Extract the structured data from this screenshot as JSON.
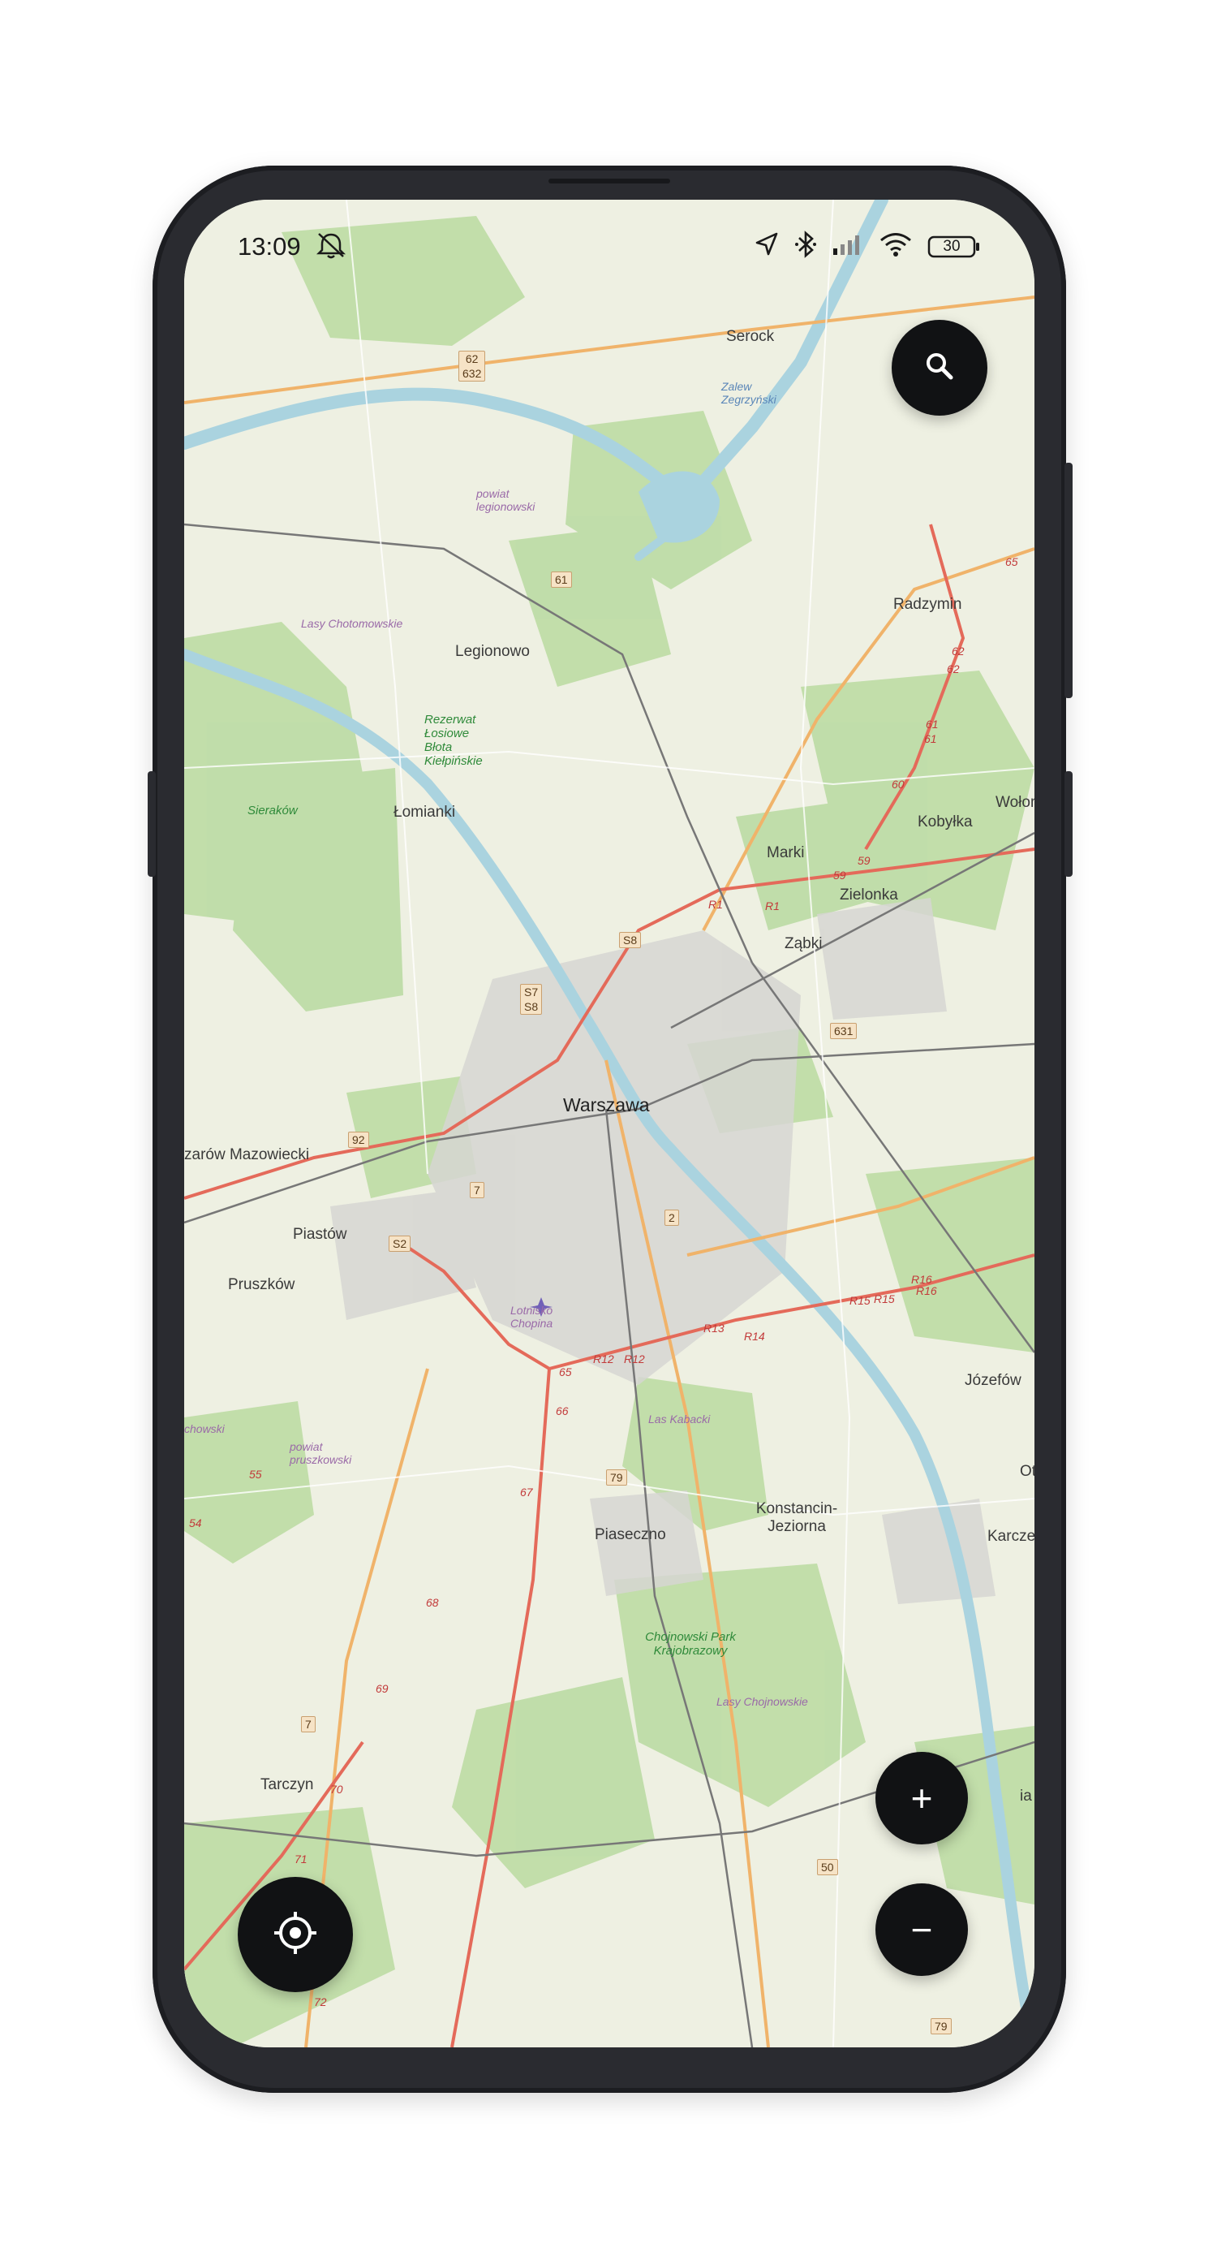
{
  "status_bar": {
    "time": "13:09",
    "battery": "30",
    "icons": [
      "bell-muted-icon",
      "location-arrow-icon",
      "bluetooth-icon",
      "signal-icon",
      "wifi-icon",
      "battery-icon"
    ]
  },
  "controls": {
    "search_icon": "search-icon",
    "zoom_in": "+",
    "zoom_out": "−",
    "locate_icon": "my-location-icon"
  },
  "map": {
    "places": {
      "serock": "Serock",
      "zalew": "Zalew Zegrzyński",
      "powiat_legionowski": "powiat legionowski",
      "lasy_chotomowskie": "Lasy Chotomowskie",
      "legionowo": "Legionowo",
      "radzymin": "Radzymin",
      "rezerwat": "Rezerwat Łosiowe Błota Kiełpińskie",
      "lomianki": "Łomianki",
      "sierakow": "Sieraków",
      "kobylka": "Kobyłka",
      "wolomin": "Wołom",
      "marki": "Marki",
      "zielonka": "Zielonka",
      "zabki": "Ząbki",
      "warszawa": "Warszawa",
      "ozarow": "zarów Mazowiecki",
      "piastow": "Piastów",
      "pruszkow": "Pruszków",
      "lotnisko": "Lotnisko Chopina",
      "jozefow": "Józefów",
      "powiat_pruszkowski": "powiat pruszkowski",
      "ochowski": "chowski",
      "las_kabacki": "Las Kabacki",
      "konstancin": "Konstancin-Jeziorna",
      "piaseczno": "Piaseczno",
      "karczew": "Karczew",
      "ot": "Ot",
      "chojnowski": "Chojnowski Park Krajobrazowy",
      "lasy_chojnowskie": "Lasy Chojnowskie",
      "tarczyn": "Tarczyn",
      "ia": "ia"
    },
    "road_shields": {
      "s62": "62\n632",
      "s61": "61",
      "s631": "631",
      "s8": "S8",
      "s57": "S7\nS8",
      "s92": "92",
      "s7a": "7",
      "s2": "2",
      "s52": "S2",
      "s79": "79",
      "s7b": "7",
      "s50": "50",
      "s79b": "79"
    },
    "route_labels": [
      "65",
      "62",
      "62",
      "61",
      "61",
      "60",
      "59",
      "59",
      "R1",
      "R1",
      "R16",
      "R15",
      "R15",
      "R16",
      "R13",
      "R14",
      "R12",
      "R12",
      "65",
      "66",
      "67",
      "55",
      "54",
      "68",
      "69",
      "70",
      "71",
      "72"
    ]
  },
  "colors": {
    "background": "#ffffff",
    "phone_frame": "#2a2b30",
    "map_land": "#eef0e2",
    "forest": "#bcdca4",
    "water": "#aad3df",
    "fab": "#111214"
  }
}
